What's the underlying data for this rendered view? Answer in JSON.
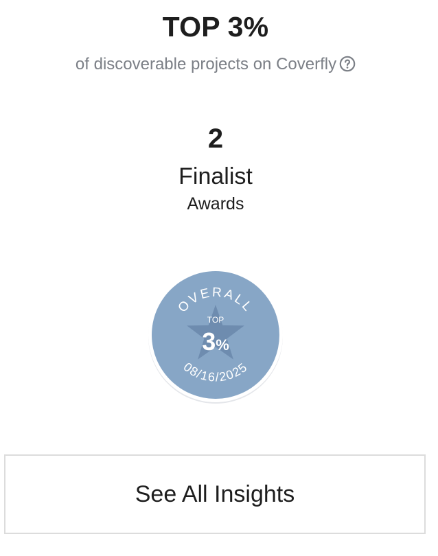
{
  "ranking": {
    "headline": "TOP 3%",
    "subtext": "of discoverable projects on Coverfly",
    "help_icon": "question-circle-icon"
  },
  "awards": {
    "count": "2",
    "title": "Finalist",
    "subtitle": "Awards"
  },
  "badge": {
    "arc_top": "OVERALL",
    "label": "TOP",
    "number": "3",
    "percent_sign": "%",
    "date": "08/16/2025",
    "icon": "star-icon",
    "colors": {
      "fill": "#87a6c6",
      "star": "#6e8caf",
      "ring": "#ffffff",
      "text": "#ffffff"
    }
  },
  "actions": {
    "see_all_insights": "See All Insights"
  }
}
